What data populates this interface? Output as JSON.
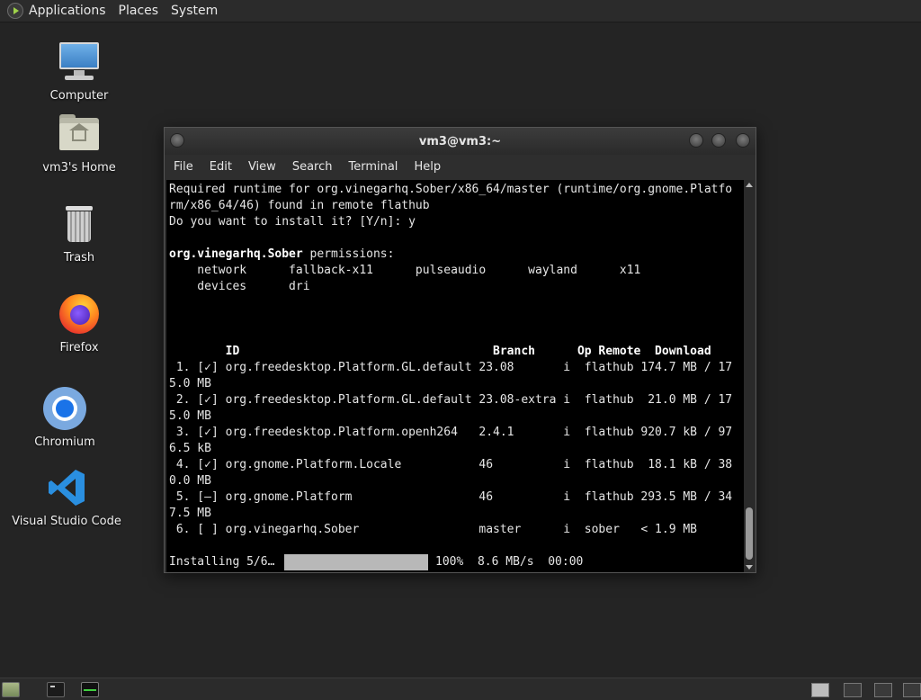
{
  "top_panel": {
    "menus": [
      "Applications",
      "Places",
      "System"
    ]
  },
  "desktop": {
    "icons": [
      {
        "label": "Computer",
        "icon": "computer-icon"
      },
      {
        "label": "vm3's Home",
        "icon": "home-folder-icon"
      },
      {
        "label": "Trash",
        "icon": "trash-icon"
      },
      {
        "label": "Firefox",
        "icon": "firefox-icon"
      },
      {
        "label": "Chromium",
        "icon": "chromium-icon"
      },
      {
        "label": "Visual Studio Code",
        "icon": "vscode-icon"
      }
    ]
  },
  "terminal": {
    "title": "vm3@vm3:~",
    "menu": [
      "File",
      "Edit",
      "View",
      "Search",
      "Terminal",
      "Help"
    ],
    "lines": [
      "Required runtime for org.vinegarhq.Sober/x86_64/master (runtime/org.gnome.Platfo",
      "rm/x86_64/46) found in remote flathub",
      "Do you want to install it? [Y/n]: y",
      "",
      "org.vinegarhq.Sober",
      " permissions:",
      "    network      fallback-x11      pulseaudio      wayland      x11",
      "    devices      dri",
      "",
      "",
      "",
      "        ID                                    Branch      Op Remote  Download",
      " 1. [✓] org.freedesktop.Platform.GL.default 23.08       i  flathub 174.7 MB / 17",
      "5.0 MB",
      " 2. [✓] org.freedesktop.Platform.GL.default 23.08-extra i  flathub  21.0 MB / 17",
      "5.0 MB",
      " 3. [✓] org.freedesktop.Platform.openh264   2.4.1       i  flathub 920.7 kB / 97",
      "6.5 kB",
      " 4. [✓] org.gnome.Platform.Locale           46          i  flathub  18.1 kB / 38",
      "0.0 MB",
      " 5. [—] org.gnome.Platform                  46          i  flathub 293.5 MB / 34",
      "7.5 MB",
      " 6. [ ] org.vinegarhq.Sober                 master      i  sober   < 1.9 MB",
      "",
      "Installing 5/6…",
      "100%  8.6 MB/s  00:00"
    ],
    "progress": 1.0
  },
  "colors": {
    "desktop_bg": "#242424",
    "terminal_bg": "#000000",
    "progress_bar": "#b8b8b8",
    "monitor_green": "#40d040"
  },
  "bottom_panel": {
    "launchers": [
      "show-desktop-icon",
      "terminal-task-icon",
      "system-monitor-icon"
    ],
    "workspaces": 4,
    "active_workspace": 1
  }
}
